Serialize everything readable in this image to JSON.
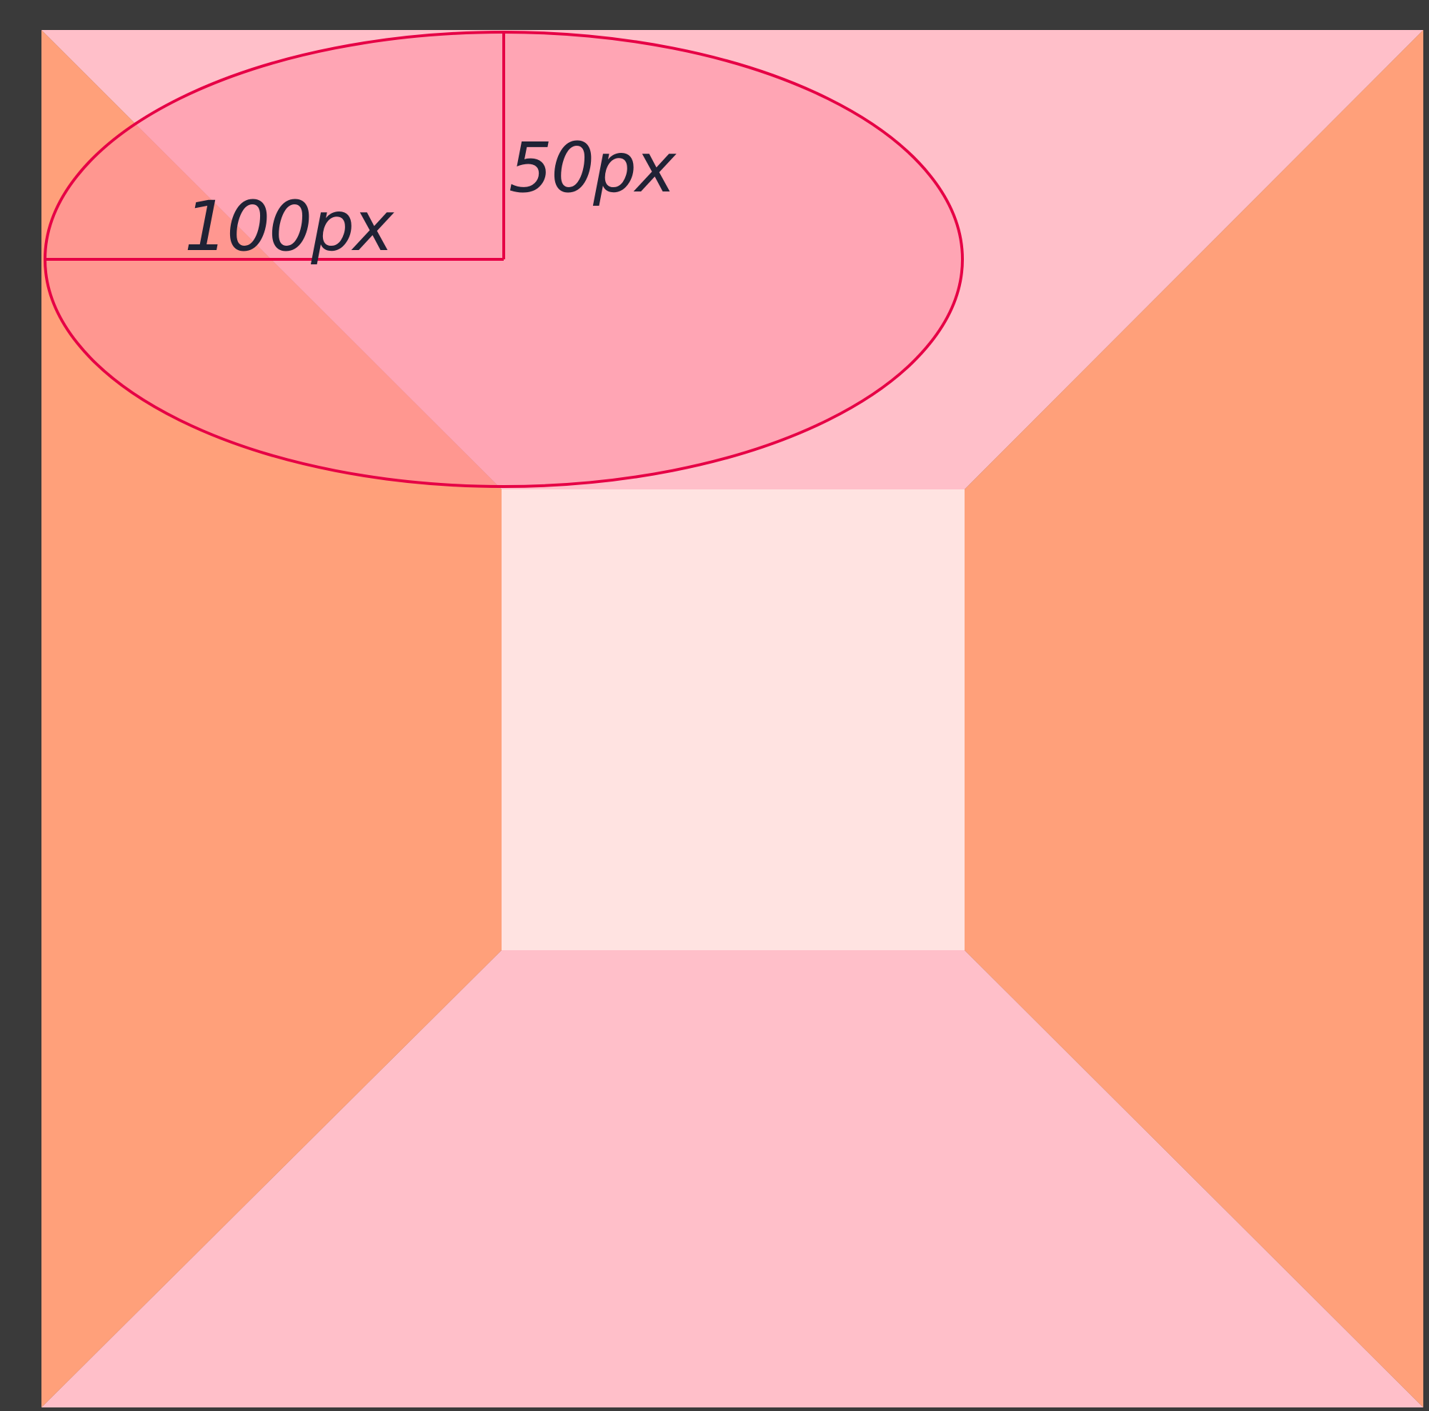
{
  "diagram": {
    "horizontal_radius_label": "100px",
    "vertical_radius_label": "50px"
  },
  "colors": {
    "background": "#3a3a3a",
    "inner_square": "#ffe3e1",
    "top_bottom_sides": "#ffbfc9",
    "left_right_sides": "#ffa07a",
    "ellipse_fill": "#ff8fa3",
    "ellipse_stroke": "#e60045",
    "label_text": "#1f2235"
  }
}
